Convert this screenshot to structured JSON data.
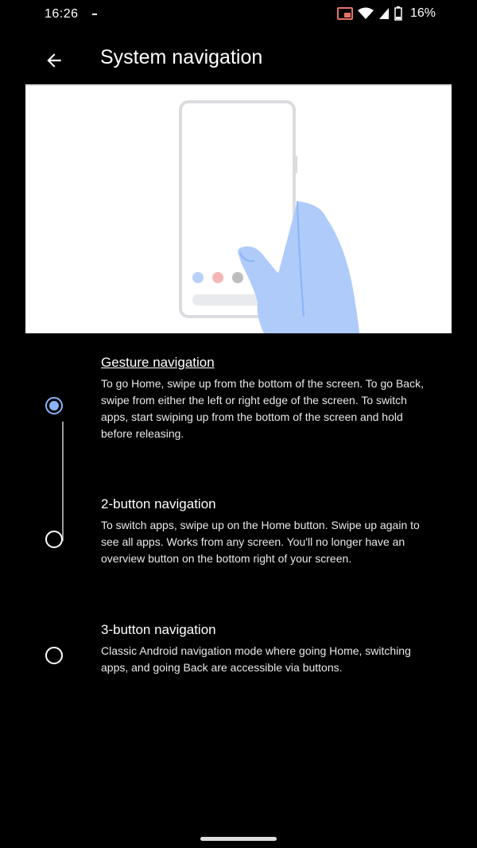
{
  "status_bar": {
    "time": "16:26",
    "battery_percent": "16%",
    "icons": [
      "cast-icon",
      "wifi-icon",
      "signal-icon",
      "battery-icon"
    ]
  },
  "app_bar": {
    "title": "System navigation",
    "back_icon": "arrow-back-icon"
  },
  "illustration": {
    "description_icon": "phone-gesture-illustration",
    "dot_colors": [
      "#b9d1f8",
      "#f4b7b4",
      "#bdbdbd",
      "#f1b7b2"
    ],
    "hand_color": "#aecbfa"
  },
  "options": [
    {
      "title": "Gesture navigation",
      "description": "To go Home, swipe up from the bottom of the screen. To go Back, swipe from either the left or right edge of the screen. To switch apps, start swiping up from the bottom of the screen and hold before releasing.",
      "selected": true
    },
    {
      "title": "2-button navigation",
      "description": "To switch apps, swipe up on the Home button. Swipe up again to see all apps. Works from any screen. You'll no longer have an overview button on the bottom right of your screen.",
      "selected": false
    },
    {
      "title": "3-button navigation",
      "description": "Classic Android navigation mode where going Home, switching apps, and going Back are accessible via buttons.",
      "selected": false
    }
  ],
  "colors": {
    "accent": "#8ab4f8",
    "background": "#000000",
    "text": "#ffffff"
  }
}
